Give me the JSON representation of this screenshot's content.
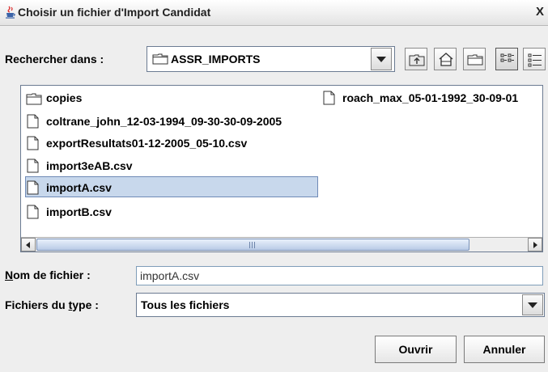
{
  "window": {
    "title": "Choisir un fichier d'Import Candidat",
    "close_glyph": "X"
  },
  "toolbar": {
    "look_in_label": "Rechercher dans :",
    "look_in_value": "ASSR_IMPORTS",
    "buttons": [
      {
        "name": "up-one-level-icon"
      },
      {
        "name": "home-icon"
      },
      {
        "name": "new-folder-icon"
      },
      {
        "name": "list-view-icon",
        "selected": true
      },
      {
        "name": "details-view-icon"
      }
    ]
  },
  "files": [
    {
      "name": "copies",
      "type": "folder"
    },
    {
      "name": "coltrane_john_12-03-1994_09-30-30-09-2005",
      "type": "file"
    },
    {
      "name": "exportResultats01-12-2005_05-10.csv",
      "type": "file"
    },
    {
      "name": "import3eAB.csv",
      "type": "file"
    },
    {
      "name": "importA.csv",
      "type": "file",
      "selected": true
    },
    {
      "name": "importB.csv",
      "type": "file"
    },
    {
      "name": "roach_max_05-01-1992_30-09-01",
      "type": "file"
    }
  ],
  "filename": {
    "label_first": "N",
    "label_rest": "om de fichier :",
    "value": "importA.csv"
  },
  "filetype": {
    "label_a": "Fichiers du ",
    "label_u": "t",
    "label_b": "ype :",
    "value": "Tous les fichiers"
  },
  "actions": {
    "open_label": "Ouvrir",
    "cancel_label": "Annuler"
  },
  "colors": {
    "selection": "#c8d8ec",
    "window_bg": "#eeeeee"
  }
}
